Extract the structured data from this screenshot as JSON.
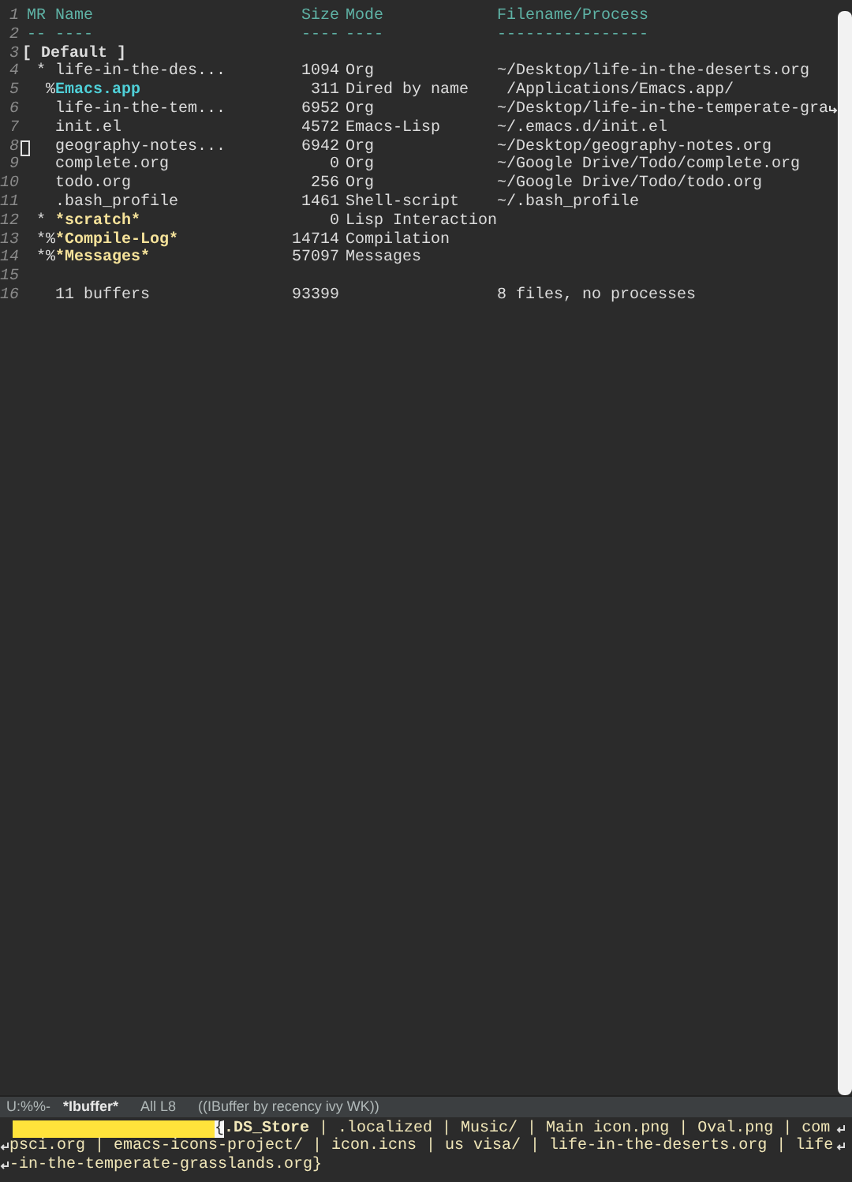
{
  "buffer": {
    "header": {
      "mr": "MR",
      "name": "Name",
      "size": "Size",
      "mode": "Mode",
      "filename": "Filename/Process"
    },
    "underline": {
      "mr": "--",
      "name": "----",
      "size": "----",
      "mode": "----",
      "filename": "----------------"
    },
    "group": "[ Default ]",
    "rows": [
      {
        "mr": " *",
        "name": "life-in-the-des...",
        "kind": "file",
        "size": "1094",
        "mode": "Org",
        "filename": "~/Desktop/life-in-the-deserts.org",
        "truncated": false,
        "cursor": false
      },
      {
        "mr": "  %",
        "name": "Emacs.app",
        "kind": "dired",
        "size": "311",
        "mode": "Dired by name",
        "filename": " /Applications/Emacs.app/",
        "truncated": false,
        "cursor": false
      },
      {
        "mr": "",
        "name": "life-in-the-tem...",
        "kind": "file",
        "size": "6952",
        "mode": "Org",
        "filename": "~/Desktop/life-in-the-temperate-gra",
        "truncated": true,
        "cursor": false
      },
      {
        "mr": "",
        "name": "init.el",
        "kind": "file",
        "size": "4572",
        "mode": "Emacs-Lisp",
        "filename": "~/.emacs.d/init.el",
        "truncated": false,
        "cursor": false
      },
      {
        "mr": "",
        "name": "geography-notes...",
        "kind": "file",
        "size": "6942",
        "mode": "Org",
        "filename": "~/Desktop/geography-notes.org",
        "truncated": false,
        "cursor": true
      },
      {
        "mr": "",
        "name": "complete.org",
        "kind": "file",
        "size": "0",
        "mode": "Org",
        "filename": "~/Google Drive/Todo/complete.org",
        "truncated": false,
        "cursor": false
      },
      {
        "mr": "",
        "name": "todo.org",
        "kind": "file",
        "size": "256",
        "mode": "Org",
        "filename": "~/Google Drive/Todo/todo.org",
        "truncated": false,
        "cursor": false
      },
      {
        "mr": "",
        "name": ".bash_profile",
        "kind": "file",
        "size": "1461",
        "mode": "Shell-script",
        "filename": "~/.bash_profile",
        "truncated": false,
        "cursor": false
      },
      {
        "mr": " *",
        "name": "*scratch*",
        "kind": "special",
        "size": "0",
        "mode": "Lisp Interaction",
        "filename": "",
        "truncated": false,
        "cursor": false
      },
      {
        "mr": " *%",
        "name": "*Compile-Log*",
        "kind": "special",
        "size": "14714",
        "mode": "Compilation",
        "filename": "",
        "truncated": false,
        "cursor": false
      },
      {
        "mr": " *%",
        "name": "*Messages*",
        "kind": "special",
        "size": "57097",
        "mode": "Messages",
        "filename": "",
        "truncated": false,
        "cursor": false
      }
    ],
    "summary": {
      "name": "11 buffers",
      "size": "93399",
      "filename": "8 files, no processes"
    },
    "line_numbers": [
      "1",
      "2",
      "3",
      "4",
      "5",
      "6",
      "7",
      "8",
      "9",
      "10",
      "11",
      "12",
      "13",
      "14",
      "15",
      "16"
    ]
  },
  "mode_line": {
    "status": "U:%%-",
    "buffer_name": "*Ibuffer*",
    "position": "All L8",
    "modes": "((IBuffer by recency ivy WK))"
  },
  "minibuffer": {
    "cursor_char": "{",
    "lines": [
      {
        "text": "**.DS_Store** | .localized | Music/ | Main icon.png | Oval.png | com",
        "continued": true,
        "wrapped": false
      },
      {
        "text": "psci.org | emacs-icons-project/ | icon.icns | us visa/ | life-in-the-deserts.org | life",
        "continued": true,
        "wrapped": true
      },
      {
        "text": "-in-the-temperate-grasslands.org}",
        "continued": false,
        "wrapped": true
      }
    ]
  }
}
